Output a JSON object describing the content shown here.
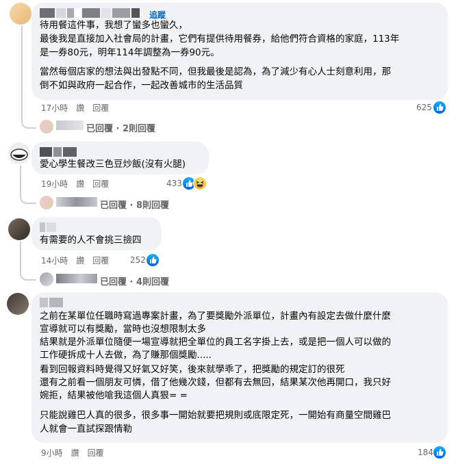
{
  "comments": [
    {
      "follow": "追蹤",
      "lines": [
        "待用餐這件事，我想了蠻多也蠻久，",
        "最後我是直接加入社會局的計畫，它們有提供待用餐券，給他們符合資格的家庭，113年",
        "是一券80元，明年114年調整為一券90元。",
        "當然每個店家的想法與出發點不同，但我最後是認為，為了減少有心人士刻意利用，那",
        "倒不如與政府一起合作，一起改善城市的生活品質"
      ],
      "time": "17小時",
      "like": "讚",
      "reply": "回覆",
      "count": "625",
      "replies": "已回覆 · 2則回覆"
    },
    {
      "lines": [
        "愛心學生餐改三色豆炒飯(沒有火腿)"
      ],
      "time": "19小時",
      "like": "讚",
      "reply": "回覆",
      "count": "433",
      "replies": "已回覆 · 8則回覆"
    },
    {
      "lines": [
        "有需要的人不會挑三撿四"
      ],
      "time": "14小時",
      "like": "讚",
      "reply": "回覆",
      "count": "252",
      "replies": "已回覆 · 4則回覆"
    },
    {
      "lines": [
        "之前在某單位任職時寫過專案計畫，為了要獎勵外派單位，計畫內有設定去做什麼什麼",
        "宣導就可以有獎勵，當時也沒想限制太多",
        "結果就是外派單位隨便一場宣導就把全單位的員工名字掛上去，或是把一個人可以做的",
        "工作硬拆成十人去做，為了賺那個獎勵.....",
        "看到回報資料時覺得又好氣又好笑，後來就學乖了，把獎勵的規定訂的很死",
        "還有之前看一個朋友可憐，借了他幾次錢，但都有去無回，結果某次他再開口，我只好",
        "婉拒，結果被他嗆我這個人真狠= =",
        "只能說雞巴人真的很多，很多事一開始就要把規則或底限定死，一開始有商量空間雞巴",
        "人就會一直試探跟情勒"
      ],
      "time": "9小時",
      "like": "讚",
      "reply": "回覆",
      "count": "184"
    }
  ],
  "colors": {
    "bubble": "#f0f2f5",
    "meta": "#65676b",
    "link": "#0064d1",
    "like": "#0866ff"
  }
}
